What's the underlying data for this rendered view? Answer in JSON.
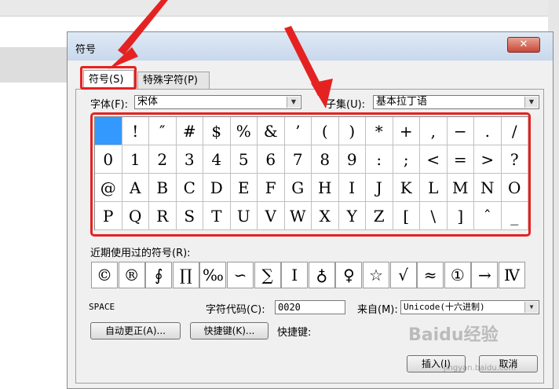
{
  "dialog": {
    "title": "符号",
    "close": "✕"
  },
  "tabs": [
    {
      "label": "符号(S)"
    },
    {
      "label": "特殊字符(P)"
    }
  ],
  "font": {
    "label": "字体(F):",
    "value": "宋体"
  },
  "subset": {
    "label": "子集(U):",
    "value": "基本拉丁语"
  },
  "symbols": [
    " ",
    "!",
    "″",
    "#",
    "$",
    "%",
    "&",
    "’",
    "(",
    ")",
    "*",
    "+",
    ",",
    "−",
    ".",
    "/",
    "0",
    "1",
    "2",
    "3",
    "4",
    "5",
    "6",
    "7",
    "8",
    "9",
    ":",
    ";",
    "<",
    "=",
    ">",
    "?",
    "@",
    "A",
    "B",
    "C",
    "D",
    "E",
    "F",
    "G",
    "H",
    "I",
    "J",
    "K",
    "L",
    "M",
    "N",
    "O",
    "P",
    "Q",
    "R",
    "S",
    "T",
    "U",
    "V",
    "W",
    "X",
    "Y",
    "Z",
    "[",
    "\\",
    "]",
    "ˆ",
    "_"
  ],
  "recent": {
    "label": "近期使用过的符号(R):",
    "symbols": [
      "©",
      "®",
      "∮",
      "∏",
      "‰",
      "∽",
      "∑",
      "Ⅰ",
      "♁",
      "♀",
      "☆",
      "√",
      "≈",
      "①",
      "→",
      "Ⅳ"
    ]
  },
  "char_name": "SPACE",
  "char_code": {
    "label": "字符代码(C):",
    "value": "0020"
  },
  "from": {
    "label": "来自(M):",
    "value": "Unicode(十六进制)"
  },
  "buttons": {
    "autocorrect": "自动更正(A)...",
    "shortcut": "快捷键(K)...",
    "shortcut_label": "快捷键:",
    "insert": "插入(I)",
    "cancel": "取消"
  },
  "watermark": {
    "text": "Baidu经验",
    "sub": "jingyan.baidu.com"
  },
  "colors": {
    "highlight": "#e52222",
    "selected": "#3399ff"
  }
}
